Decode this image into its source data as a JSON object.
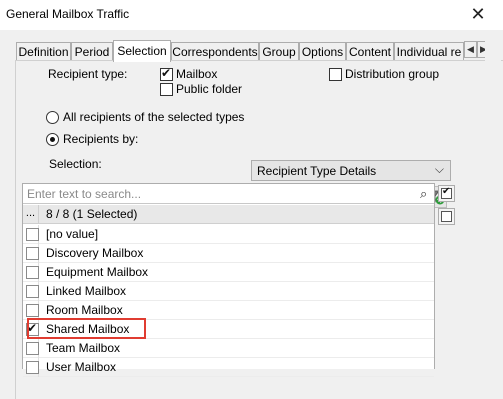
{
  "window": {
    "title": "General Mailbox Traffic",
    "close_glyph": "✕"
  },
  "tabs": [
    {
      "label": "Definition",
      "active": false
    },
    {
      "label": "Period",
      "active": false
    },
    {
      "label": "Selection",
      "active": true
    },
    {
      "label": "Correspondents",
      "active": false
    },
    {
      "label": "Group",
      "active": false
    },
    {
      "label": "Options",
      "active": false
    },
    {
      "label": "Content",
      "active": false
    },
    {
      "label": "Individual re",
      "active": false
    }
  ],
  "tab_scroll": {
    "left": "◀",
    "right": "▶"
  },
  "recipient_type": {
    "label": "Recipient type:",
    "mailbox": {
      "label": "Mailbox",
      "checked": true
    },
    "public_folder": {
      "label": "Public folder",
      "checked": false
    },
    "distribution_group": {
      "label": "Distribution group",
      "checked": false
    }
  },
  "scope": {
    "all_recipients": {
      "label": "All recipients of the selected types",
      "selected": false
    },
    "recipients_by": {
      "label": "Recipients by:",
      "selected": true
    },
    "recipients_by_value": "Recipient Type Details",
    "dropdown_arrow": "⌵"
  },
  "selection": {
    "label": "Selection:",
    "toolbar": {
      "filter_icon": "filter-icon",
      "refresh_filter_icon": "filter-refresh-icon"
    },
    "search_placeholder": "Enter text to search...",
    "search_icon_glyph": "⌕",
    "header_dots": "...",
    "header_count": "8 / 8 (1 Selected)",
    "items": [
      {
        "label": "[no value]",
        "checked": false
      },
      {
        "label": "Discovery Mailbox",
        "checked": false
      },
      {
        "label": "Equipment Mailbox",
        "checked": false
      },
      {
        "label": "Linked Mailbox",
        "checked": false
      },
      {
        "label": "Room Mailbox",
        "checked": false
      },
      {
        "label": "Shared Mailbox",
        "checked": true
      },
      {
        "label": "Team Mailbox",
        "checked": false
      },
      {
        "label": "User Mailbox",
        "checked": false
      }
    ],
    "select_all_checked": true,
    "select_none_checked": false
  },
  "colors": {
    "highlight": "#e03c31",
    "dialog_bg": "#f0f0f0"
  }
}
